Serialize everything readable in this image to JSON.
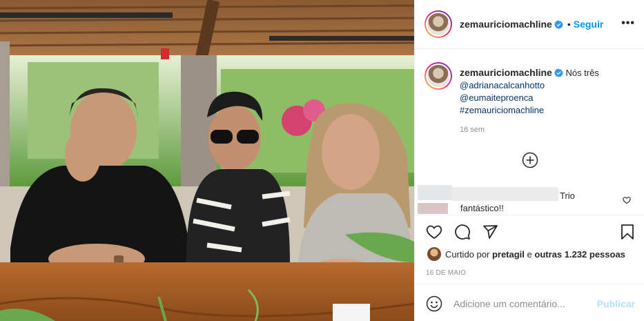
{
  "post": {
    "image_alt": "",
    "author": "zemauriciomachline",
    "verified": true,
    "follow_separator": "•",
    "follow_label": "Seguir",
    "more_label": "•••"
  },
  "caption": {
    "username": "zemauriciomachline",
    "text": "Nós três",
    "mentions": [
      "@adrianacalcanhotto",
      "@eumaiteproenca",
      "#zemauriciomachline"
    ],
    "age": "16 sem"
  },
  "comments": [
    {
      "text": "Trio fantástico!!"
    }
  ],
  "likes": {
    "prefix": "Curtido por",
    "user": "pretagil",
    "connector": "e",
    "others": "outras 1.232 pessoas"
  },
  "date": "16 DE MAIO",
  "add_comment": {
    "placeholder": "Adicione um comentário...",
    "publish_label": "Publicar"
  },
  "icons": {
    "verified": "verified-badge-icon",
    "more": "more-options-icon",
    "load_more": "plus-circle-icon",
    "like": "heart-icon",
    "comment": "comment-bubble-icon",
    "share": "paper-plane-icon",
    "save": "bookmark-icon",
    "emoji": "emoji-icon"
  },
  "colors": {
    "accent": "#0095f6",
    "link": "#00376b",
    "muted": "#8e8e8e",
    "publish_disabled": "#b2dffc",
    "border": "#efefef"
  }
}
